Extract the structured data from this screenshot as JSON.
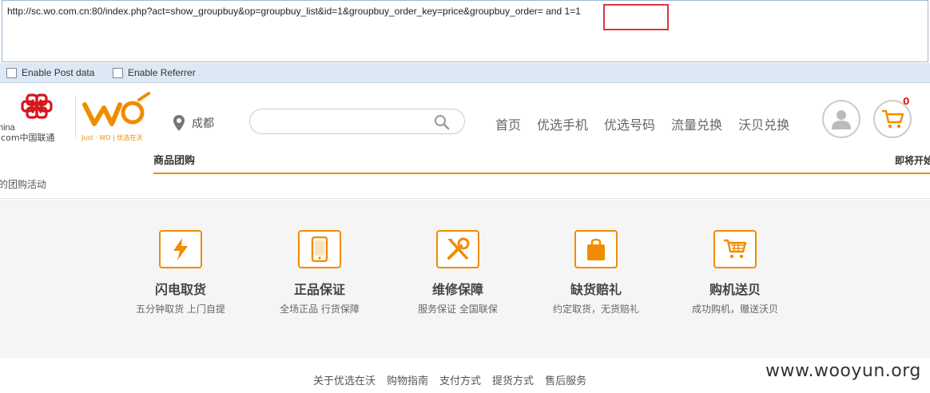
{
  "hackbar": {
    "url_prefix": "http://sc.wo.com.cn:80/index.php?act=show_groupbuy&op=groupbuy_list&id=1&groupbuy_order_key=price&groupbuy_order=",
    "url_injection": " and 1=1",
    "enable_post": "Enable Post data",
    "enable_referrer": "Enable Referrer"
  },
  "header": {
    "logo_unicom_text_a": "hina",
    "logo_unicom_text_b": "icom中国联通",
    "logo_wo_slogan": "Just · WO | 优选在沃",
    "city": "成都",
    "search_placeholder": "",
    "nav": [
      "首页",
      "优选手机",
      "优选号码",
      "流量兑换",
      "沃贝兑换"
    ],
    "cart_count": "0"
  },
  "subnav": {
    "tab_group": "商品团购",
    "tab_upcoming": "即将开始",
    "activity_title": "的团购活动"
  },
  "features": [
    {
      "icon": "lightning-icon",
      "title": "闪电取货",
      "sub": "五分钟取货 上门自提"
    },
    {
      "icon": "phone-icon",
      "title": "正品保证",
      "sub": "全场正品 行货保障"
    },
    {
      "icon": "tools-icon",
      "title": "维修保障",
      "sub": "服务保证 全国联保"
    },
    {
      "icon": "bag-icon",
      "title": "缺货赔礼",
      "sub": "约定取货，无货赔礼"
    },
    {
      "icon": "cart-icon",
      "title": "购机送贝",
      "sub": "成功购机，赠送沃贝"
    }
  ],
  "footer": {
    "links": [
      "关于优选在沃",
      "购物指南",
      "支付方式",
      "提货方式",
      "售后服务"
    ],
    "watermark": "www.wooyun.org"
  },
  "colors": {
    "accent": "#f08c00",
    "unicom_red": "#d7151d",
    "highlight_box": "#d9383a",
    "hackbar_bar": "#dde8f4"
  }
}
